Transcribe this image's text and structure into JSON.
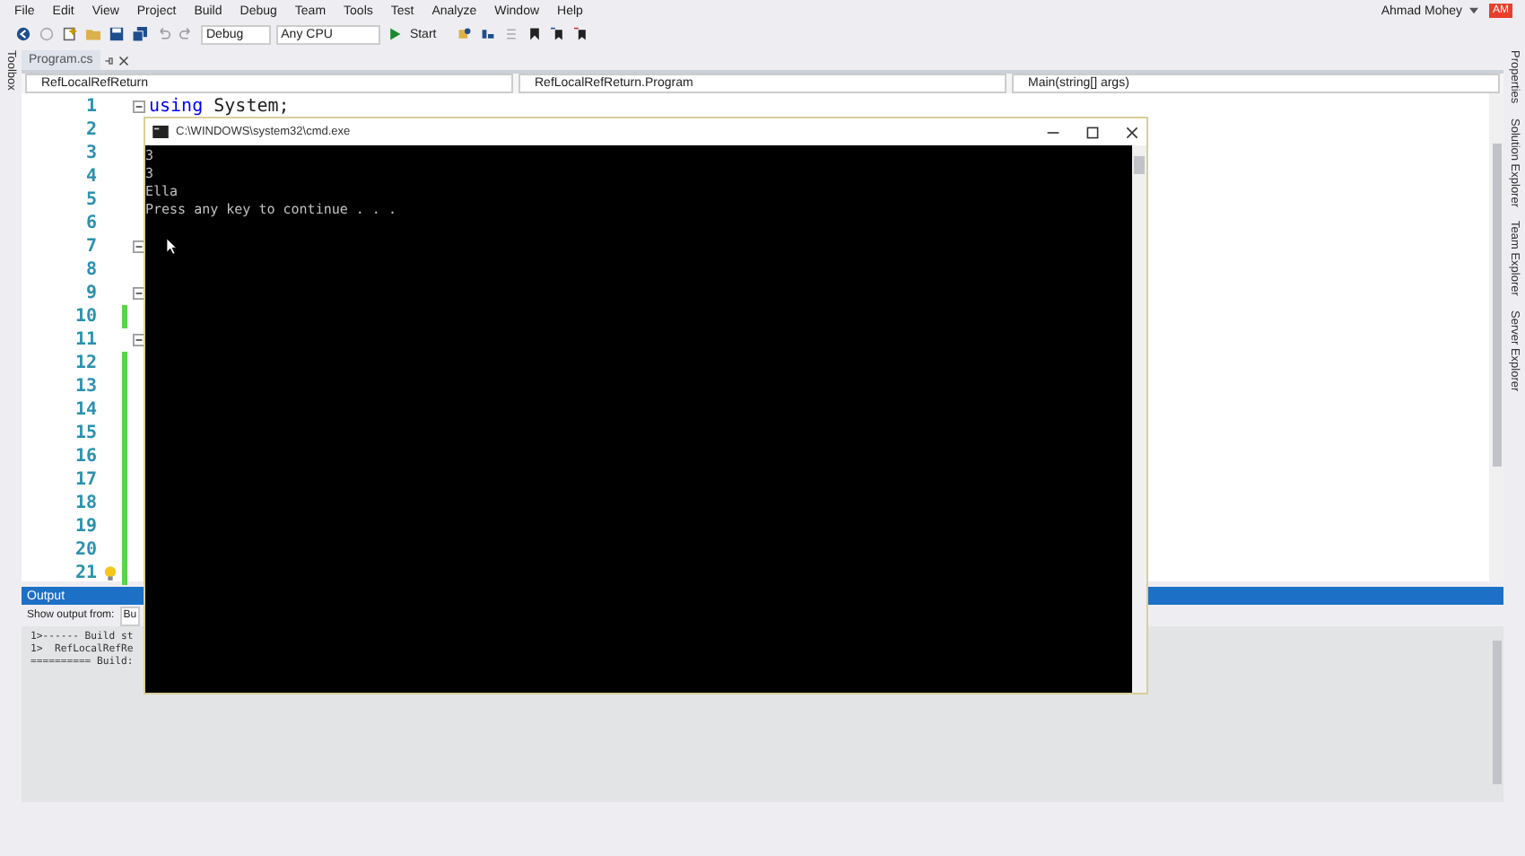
{
  "menu": [
    "File",
    "Edit",
    "View",
    "Project",
    "Build",
    "Debug",
    "Team",
    "Tools",
    "Test",
    "Analyze",
    "Window",
    "Help"
  ],
  "user": {
    "name": "Ahmad Mohey",
    "initials": "AM"
  },
  "toolbar": {
    "configuration": "Debug",
    "platform": "Any CPU",
    "start": "Start"
  },
  "left_strip": [
    "Toolbox"
  ],
  "right_strip": [
    "Properties",
    "Solution Explorer",
    "Team Explorer",
    "Server Explorer"
  ],
  "document_tab": {
    "title": "Program.cs",
    "selected": true
  },
  "navigation": {
    "project": "RefLocalRefReturn",
    "type": "RefLocalRefReturn.Program",
    "member": "Main(string[] args)"
  },
  "lines": [
    {
      "number": "1",
      "keyword": "using",
      "text": " System;",
      "collapsible": true,
      "changed": false
    },
    {
      "number": "2",
      "collapsible": false,
      "changed": false
    },
    {
      "number": "3",
      "collapsible": false,
      "changed": false
    },
    {
      "number": "4",
      "collapsible": false,
      "changed": false
    },
    {
      "number": "5",
      "collapsible": false,
      "changed": false
    },
    {
      "number": "6",
      "collapsible": false,
      "changed": false
    },
    {
      "number": "7",
      "collapsible": true,
      "changed": false
    },
    {
      "number": "8",
      "collapsible": false,
      "changed": false
    },
    {
      "number": "9",
      "collapsible": true,
      "changed": false
    },
    {
      "number": "10",
      "collapsible": false,
      "changed": true
    },
    {
      "number": "11",
      "collapsible": true,
      "changed": false
    },
    {
      "number": "12",
      "collapsible": false,
      "changed": true
    },
    {
      "number": "13",
      "collapsible": false,
      "changed": true
    },
    {
      "number": "14",
      "collapsible": false,
      "changed": true
    },
    {
      "number": "15",
      "collapsible": false,
      "changed": true
    },
    {
      "number": "16",
      "collapsible": false,
      "changed": true
    },
    {
      "number": "17",
      "collapsible": false,
      "changed": true
    },
    {
      "number": "18",
      "collapsible": false,
      "changed": true
    },
    {
      "number": "19",
      "collapsible": false,
      "changed": true
    },
    {
      "number": "20",
      "collapsible": false,
      "changed": true
    },
    {
      "number": "21",
      "collapsible": false,
      "changed": true,
      "lightbulb": true
    }
  ],
  "output": {
    "title": "Output",
    "show_from_label": "Show output from:",
    "source": "Bu",
    "lines": [
      "1>------ Build st",
      "1>  RefLocalRefRe",
      "========== Build:"
    ]
  },
  "console": {
    "title": "C:\\WINDOWS\\system32\\cmd.exe",
    "lines": [
      "3",
      "3",
      "Ella",
      "Press any key to continue . . ."
    ]
  }
}
